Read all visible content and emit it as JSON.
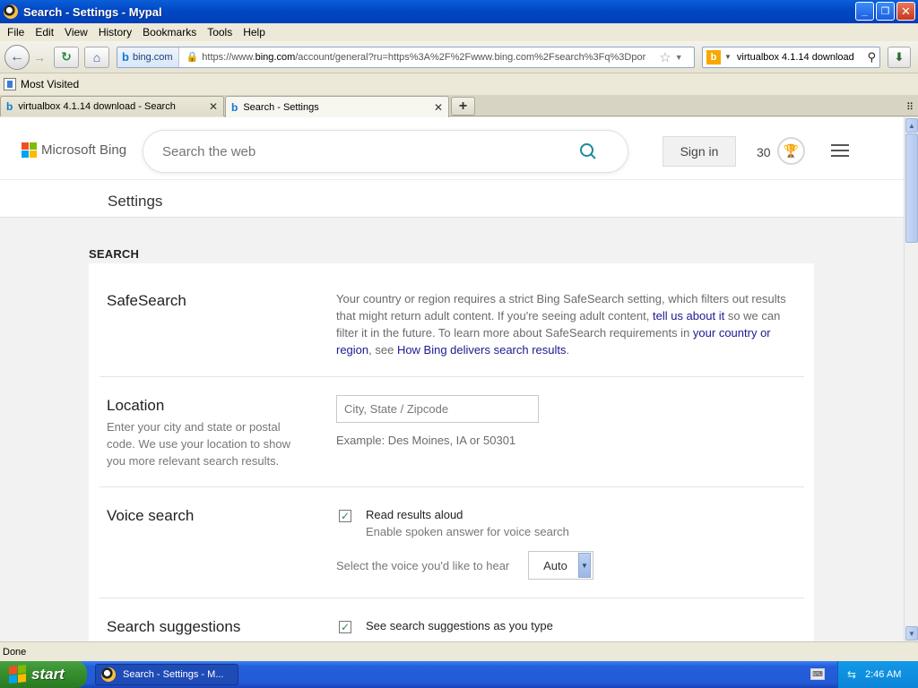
{
  "window": {
    "title": "Search - Settings - Mypal",
    "minimize_glyph": "_",
    "maximize_glyph": "❐",
    "close_glyph": "✕"
  },
  "menu": [
    "File",
    "Edit",
    "View",
    "History",
    "Bookmarks",
    "Tools",
    "Help"
  ],
  "nav": {
    "site_badge": "bing.com",
    "url_prefix": "https://www.",
    "url_host": "bing.com",
    "url_rest": "/account/general?ru=https%3A%2F%2Fwww.bing.com%2Fsearch%3Fq%3Dpor",
    "search_engine": "b",
    "search_query": "virtualbox 4.1.14 download"
  },
  "bookmarks": {
    "most_visited": "Most Visited"
  },
  "tabs": [
    {
      "label": "virtualbox 4.1.14 download - Search",
      "active": false
    },
    {
      "label": "Search - Settings",
      "active": true
    }
  ],
  "bing": {
    "brand": "Microsoft Bing",
    "search_placeholder": "Search the web",
    "sign_in": "Sign in",
    "points": "30"
  },
  "settings": {
    "page_title": "Settings",
    "section_label": "SEARCH",
    "safesearch": {
      "title": "SafeSearch",
      "text_1": "Your country or region requires a strict Bing SafeSearch setting, which filters out results that might return adult content. If you're seeing adult content, ",
      "link_1": "tell us about it",
      "text_2": " so we can filter it in the future. To learn more about SafeSearch requirements in ",
      "link_2": "your country or region",
      "text_3": ", see ",
      "link_3": "How Bing delivers search results",
      "text_4": "."
    },
    "location": {
      "title": "Location",
      "description": "Enter your city and state or postal code. We use your location to show you more relevant search results.",
      "placeholder": "City, State / Zipcode",
      "example": "Example: Des Moines, IA or 50301"
    },
    "voice": {
      "title": "Voice search",
      "checkbox_label": "Read results aloud",
      "checkbox_checked": true,
      "checkbox_sub": "Enable spoken answer for voice search",
      "select_label": "Select the voice you'd like to hear",
      "select_value": "Auto"
    },
    "suggestions": {
      "title": "Search suggestions",
      "checkbox_label": "See search suggestions as you type",
      "checkbox_checked": true
    }
  },
  "status": {
    "text": "Done"
  },
  "taskbar": {
    "start": "start",
    "item": "Search - Settings - M...",
    "clock": "2:46 AM"
  }
}
